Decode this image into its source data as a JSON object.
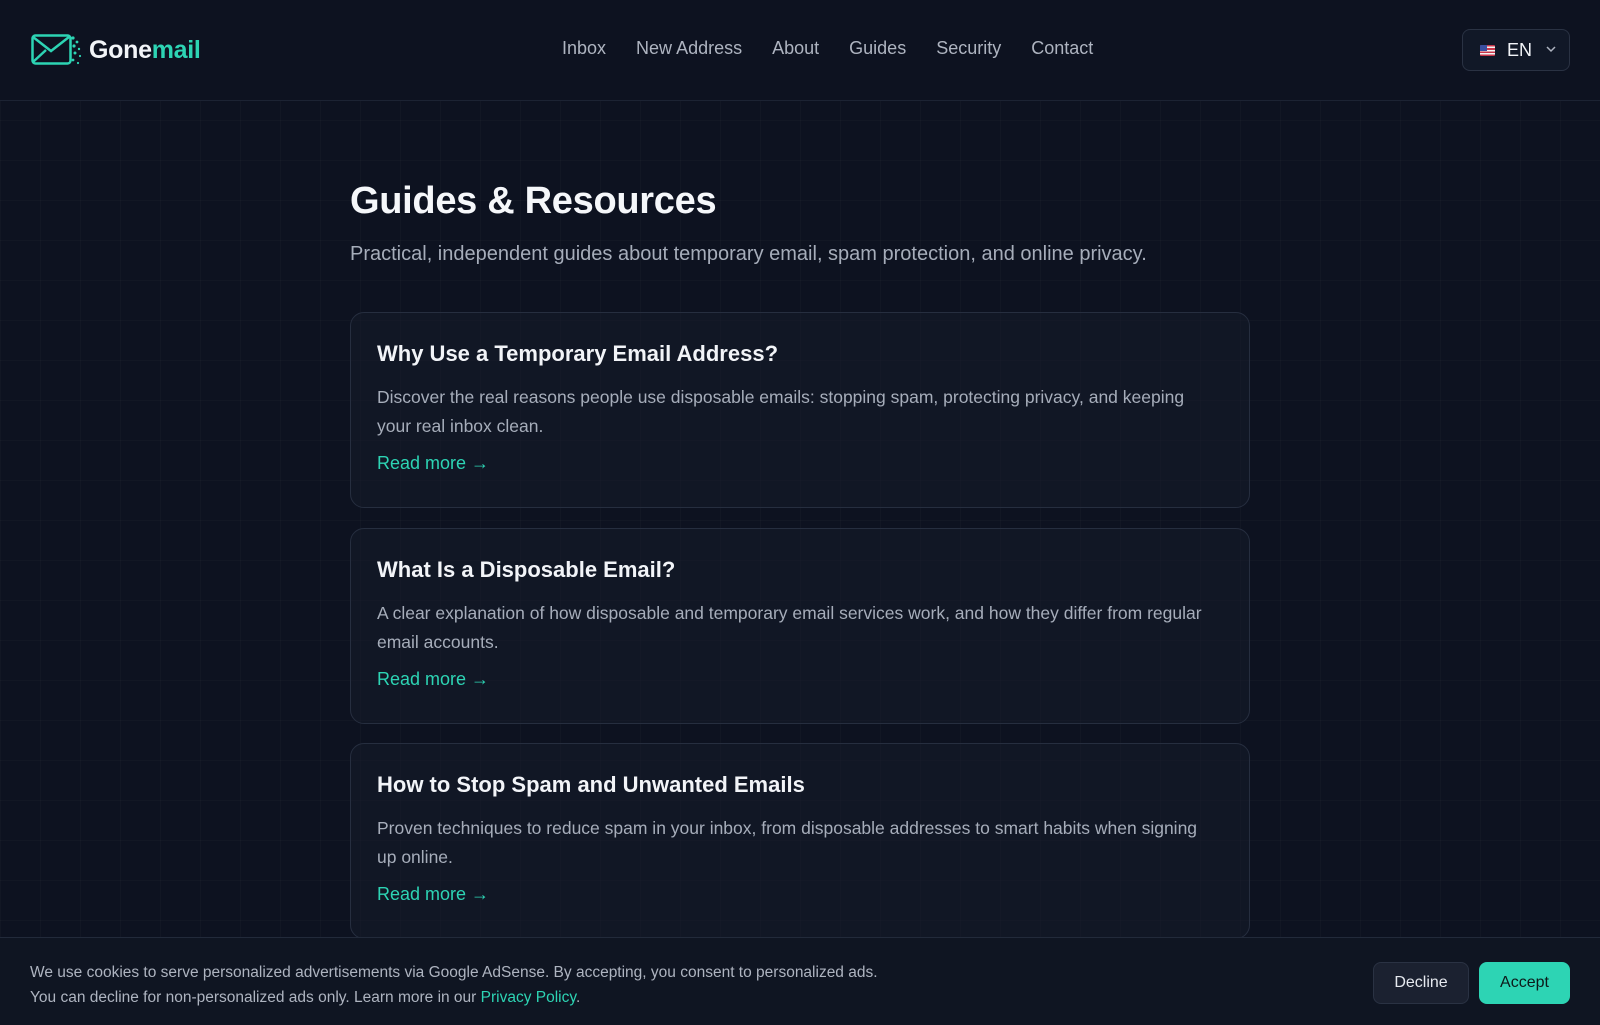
{
  "header": {
    "logo": {
      "word_white": "Gone",
      "word_accent": "mail"
    },
    "nav": [
      "Inbox",
      "New Address",
      "About",
      "Guides",
      "Security",
      "Contact"
    ],
    "language": {
      "code": "EN",
      "flag": "us-flag-icon"
    }
  },
  "main": {
    "title": "Guides & Resources",
    "subtitle": "Practical, independent guides about temporary email, spam protection, and online privacy.",
    "guides": [
      {
        "title": "Why Use a Temporary Email Address?",
        "description": "Discover the real reasons people use disposable emails: stopping spam, protecting privacy, and keeping your real inbox clean.",
        "link": "Read more →"
      },
      {
        "title": "What Is a Disposable Email?",
        "description": "A clear explanation of how disposable and temporary email services work, and how they differ from regular email accounts.",
        "link": "Read more →"
      },
      {
        "title": "How to Stop Spam and Unwanted Emails",
        "description": "Proven techniques to reduce spam in your inbox, from disposable addresses to smart habits when signing up online.",
        "link": "Read more →"
      }
    ]
  },
  "cookie_banner": {
    "text": "We use cookies to serve personalized advertisements via Google AdSense. By accepting, you consent to personalized ads. You can decline for non-personalized ads only. Learn more in our ",
    "link": "Privacy Policy",
    "after_link": ".",
    "decline": "Decline",
    "accept": "Accept"
  },
  "colors": {
    "background": "#0d1220",
    "accent": "#2dd4b4",
    "card_border": "#262e3f"
  }
}
